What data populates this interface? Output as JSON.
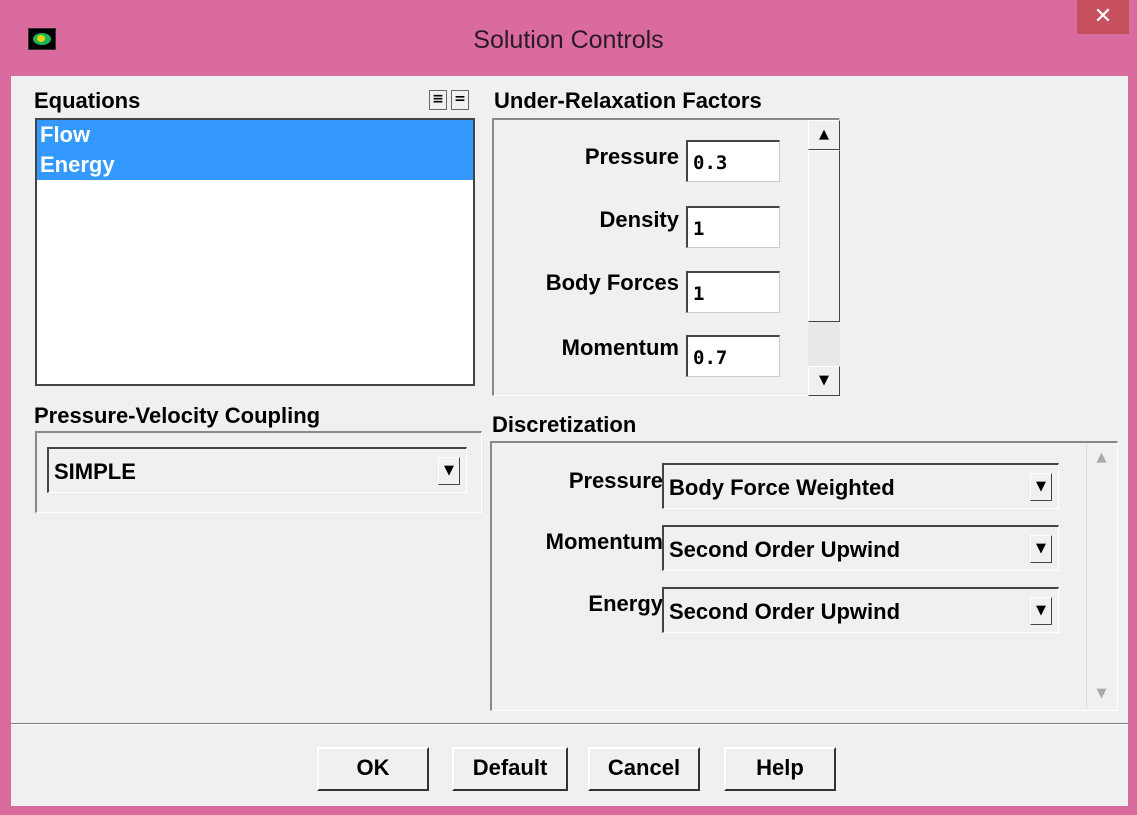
{
  "window": {
    "title": "Solution Controls",
    "close_label": "✕",
    "title_bar_color": "#d96b9e"
  },
  "equations": {
    "label": "Equations",
    "items": [
      "Flow",
      "Energy"
    ],
    "select_all_icon": "≡",
    "deselect_all_icon": "="
  },
  "urf": {
    "label": "Under-Relaxation Factors",
    "fields": [
      {
        "label": "Pressure",
        "value": "0.3"
      },
      {
        "label": "Density",
        "value": "1"
      },
      {
        "label": "Body Forces",
        "value": "1"
      },
      {
        "label": "Momentum",
        "value": "0.7"
      }
    ]
  },
  "pv_coupling": {
    "label": "Pressure-Velocity Coupling",
    "value": "SIMPLE"
  },
  "discretization": {
    "label": "Discretization",
    "fields": [
      {
        "label": "Pressure",
        "value": "Body Force Weighted"
      },
      {
        "label": "Momentum",
        "value": "Second Order Upwind"
      },
      {
        "label": "Energy",
        "value": "Second Order Upwind"
      }
    ]
  },
  "buttons": {
    "ok": "OK",
    "default": "Default",
    "cancel": "Cancel",
    "help": "Help"
  },
  "icons": {
    "up": "▲",
    "down": "▼",
    "dropdown": "▼"
  }
}
